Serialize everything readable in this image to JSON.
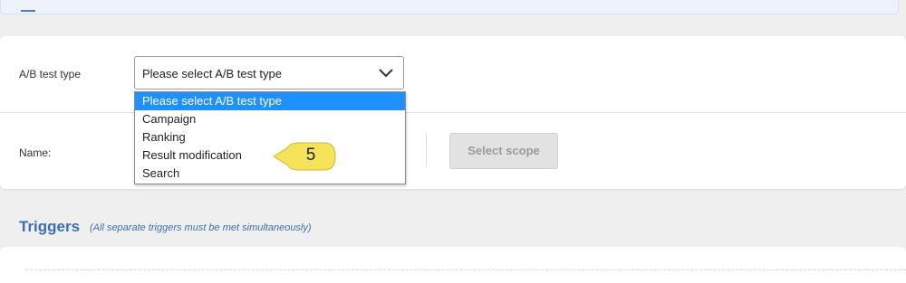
{
  "form": {
    "ab_type_label": "A/B test type",
    "ab_type_selected": "Please select A/B test type",
    "name_label": "Name:",
    "select_scope_label": "Select scope"
  },
  "dropdown": {
    "options": [
      "Please select A/B test type",
      "Campaign",
      "Ranking",
      "Result modification",
      "Search"
    ],
    "highlighted_index": 0
  },
  "callout": {
    "number": "5"
  },
  "triggers": {
    "title": "Triggers",
    "note": "(All separate triggers must be met simultaneously)"
  },
  "colors": {
    "accent": "#3b6fb5",
    "highlight": "#1e90ff",
    "callout": "#f7e35a"
  }
}
